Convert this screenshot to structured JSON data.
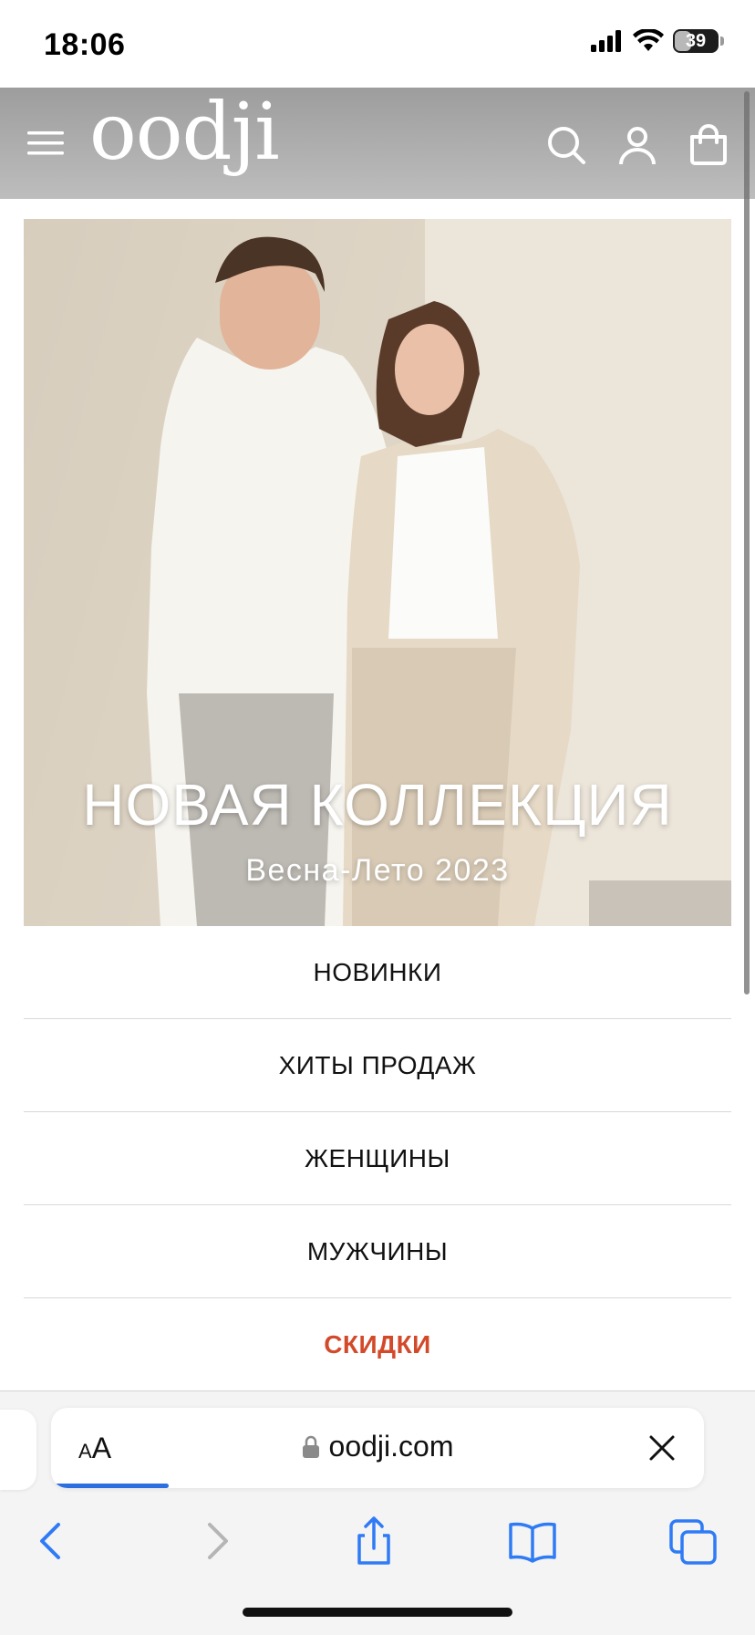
{
  "status_bar": {
    "time": "18:06",
    "battery": "39",
    "battery_level": 0.39,
    "signal": "cellular-signal-icon",
    "wifi": "wifi-icon"
  },
  "header": {
    "logo": "oodji",
    "icons": [
      "menu-icon",
      "search-icon",
      "user-icon",
      "cart-icon"
    ]
  },
  "hero": {
    "title": "НОВАЯ КОЛЛЕКЦИЯ",
    "subtitle": "Весна-Лето 2023"
  },
  "categories": [
    {
      "label": "НОВИНКИ"
    },
    {
      "label": "ХИТЫ ПРОДАЖ"
    },
    {
      "label": "ЖЕНЩИНЫ"
    },
    {
      "label": "МУЖЧИНЫ"
    },
    {
      "label": "СКИДКИ"
    }
  ],
  "browser": {
    "text_size_label": "AA",
    "url": "oodji.com",
    "load_progress": 0.18,
    "toolbar_icons": [
      "back-icon",
      "forward-icon",
      "share-icon",
      "bookmarks-icon",
      "tabs-icon"
    ]
  },
  "colors": {
    "sale": "#d24a2a",
    "progress": "#2b6fe0",
    "header_bg": "#a8a8a8"
  }
}
